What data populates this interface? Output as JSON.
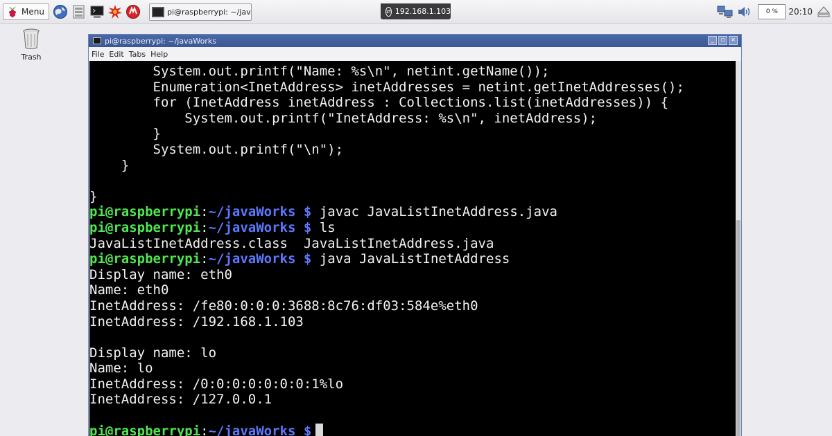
{
  "panel": {
    "menu_label": "Menu",
    "task_label": "pi@raspberrypi: ~/jav...",
    "vnc_ip": "192.168.1.103",
    "cpu_usage": "0 %",
    "clock": "20:10"
  },
  "desktop": {
    "trash_label": "Trash"
  },
  "window": {
    "title": "pi@raspberrypi: ~/javaWorks",
    "menu": [
      "File",
      "Edit",
      "Tabs",
      "Help"
    ],
    "controls": [
      "_",
      "▫",
      "×"
    ]
  },
  "terminal": {
    "prompt_user": "pi@raspberrypi",
    "prompt_path": "~/javaWorks",
    "prompt_sign": "$",
    "lines": [
      "        System.out.printf(\"Name: %s\\n\", netint.getName());",
      "        Enumeration<InetAddress> inetAddresses = netint.getInetAddresses();",
      "        for (InetAddress inetAddress : Collections.list(inetAddresses)) {",
      "            System.out.printf(\"InetAddress: %s\\n\", inetAddress);",
      "        }",
      "        System.out.printf(\"\\n\");",
      "    }",
      "",
      "}"
    ],
    "cmd_javac": "javac JavaListInetAddress.java",
    "cmd_ls": "ls",
    "ls_output": "JavaListInetAddress.class  JavaListInetAddress.java",
    "cmd_java": "java JavaListInetAddress",
    "output": [
      "Display name: eth0",
      "Name: eth0",
      "InetAddress: /fe80:0:0:0:3688:8c76:df03:584e%eth0",
      "InetAddress: /192.168.1.103",
      "",
      "Display name: lo",
      "Name: lo",
      "InetAddress: /0:0:0:0:0:0:0:1%lo",
      "InetAddress: /127.0.0.1",
      ""
    ]
  },
  "colors": {
    "prompt_user": "#4fe84f",
    "prompt_path": "#5c78ff",
    "terminal_bg": "#000000",
    "titlebar": "#4563a3"
  },
  "icons": [
    "raspberry-icon",
    "globe-icon",
    "file-manager-icon",
    "terminal-icon",
    "math-icon",
    "wolfram-icon",
    "vnc-icon",
    "network-icon",
    "volume-icon",
    "eject-icon",
    "trash-icon"
  ]
}
